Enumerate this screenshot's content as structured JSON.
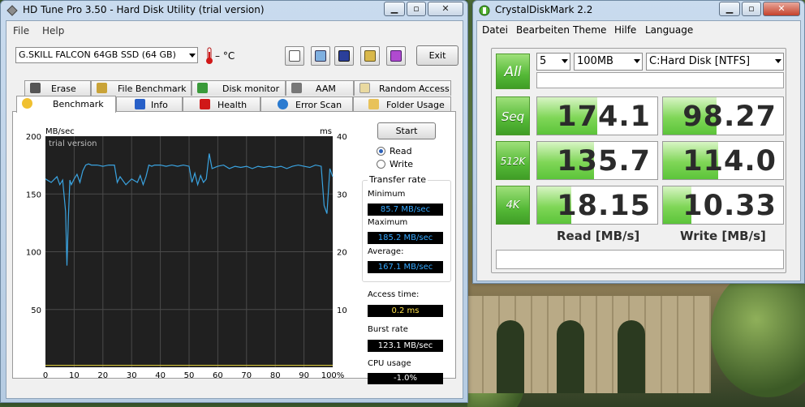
{
  "hdtune": {
    "title": "HD Tune Pro 3.50 - Hard Disk Utility (trial version)",
    "menu": {
      "file": "File",
      "help": "Help"
    },
    "drive": "G.SKILL FALCON 64GB SSD (64 GB)",
    "temperature": "– °C",
    "exit_label": "Exit",
    "tabs_top": [
      "Erase",
      "File Benchmark",
      "Disk monitor",
      "AAM",
      "Random Access"
    ],
    "tabs_bottom": [
      "Benchmark",
      "Info",
      "Health",
      "Error Scan",
      "Folder Usage"
    ],
    "start_label": "Start",
    "read_label": "Read",
    "write_label": "Write",
    "transfer_rate_title": "Transfer rate",
    "minimum_label": "Minimum",
    "minimum_value": "85.7 MB/sec",
    "maximum_label": "Maximum",
    "maximum_value": "185.2 MB/sec",
    "average_label": "Average:",
    "average_value": "167.1 MB/sec",
    "access_time_label": "Access time:",
    "access_time_value": "0.2 ms",
    "burst_rate_label": "Burst rate",
    "burst_rate_value": "123.1 MB/sec",
    "cpu_usage_label": "CPU usage",
    "cpu_usage_value": "-1.0%",
    "graph": {
      "y_left_unit": "MB/sec",
      "y_right_unit": "ms",
      "watermark": "trial version",
      "y_left_ticks": [
        "200",
        "150",
        "100",
        "50"
      ],
      "y_right_ticks": [
        "40",
        "30",
        "20",
        "10"
      ],
      "x_ticks": [
        "0",
        "10",
        "20",
        "30",
        "40",
        "50",
        "60",
        "70",
        "80",
        "90",
        "100%"
      ]
    },
    "colors": {
      "trace": "#3aa3e0",
      "access": "#d4c23a",
      "value_text": "#35a8ff",
      "value_yellow": "#ffe14a"
    }
  },
  "chart_data": {
    "type": "line",
    "xlabel": "",
    "ylabel": "MB/sec",
    "xlim": [
      0,
      100
    ],
    "ylim": [
      0,
      200
    ],
    "grid": true,
    "series": [
      {
        "x": [
          0,
          2,
          4,
          5,
          6,
          7,
          7.5,
          8,
          8.5,
          9,
          10,
          11,
          12,
          13,
          14,
          15,
          16,
          18,
          20,
          22,
          24,
          25,
          26,
          28,
          30,
          32,
          33,
          34,
          35,
          36,
          37,
          38,
          40,
          42,
          44,
          46,
          48,
          50,
          51,
          52,
          53,
          54,
          55,
          56,
          57,
          58,
          60,
          62,
          64,
          66,
          68,
          70,
          72,
          74,
          76,
          78,
          80,
          82,
          84,
          86,
          88,
          90,
          92,
          94,
          96,
          97,
          98,
          99,
          100
        ],
        "values": [
          163,
          160,
          165,
          158,
          162,
          135,
          88,
          130,
          162,
          158,
          163,
          167,
          160,
          170,
          175,
          176,
          175,
          175,
          174,
          175,
          175,
          160,
          165,
          158,
          163,
          160,
          166,
          158,
          165,
          175,
          174,
          175,
          175,
          174,
          175,
          174,
          175,
          174,
          160,
          168,
          158,
          166,
          160,
          163,
          185,
          172,
          174,
          175,
          172,
          174,
          173,
          174,
          172,
          174,
          173,
          174,
          173,
          174,
          172,
          174,
          175,
          174,
          173,
          175,
          174,
          140,
          133,
          172,
          165
        ]
      }
    ]
  },
  "cdm": {
    "title": "CrystalDiskMark 2.2",
    "menu": [
      "Datei",
      "Bearbeiten",
      "Theme",
      "Hilfe",
      "Language"
    ],
    "all_label": "All",
    "runs": "5",
    "size": "100MB",
    "drive": "C:Hard Disk [NTFS]",
    "rows": [
      {
        "label": "Seq",
        "read": "174.1",
        "write": "98.27",
        "read_value": 174.1,
        "write_value": 98.27
      },
      {
        "label": "512K",
        "read": "135.7",
        "write": "114.0",
        "read_value": 135.7,
        "write_value": 114.0
      },
      {
        "label": "4K",
        "read": "18.15",
        "write": "10.33",
        "read_value": 18.15,
        "write_value": 10.33
      }
    ],
    "read_header": "Read [MB/s]",
    "write_header": "Write [MB/s]"
  }
}
